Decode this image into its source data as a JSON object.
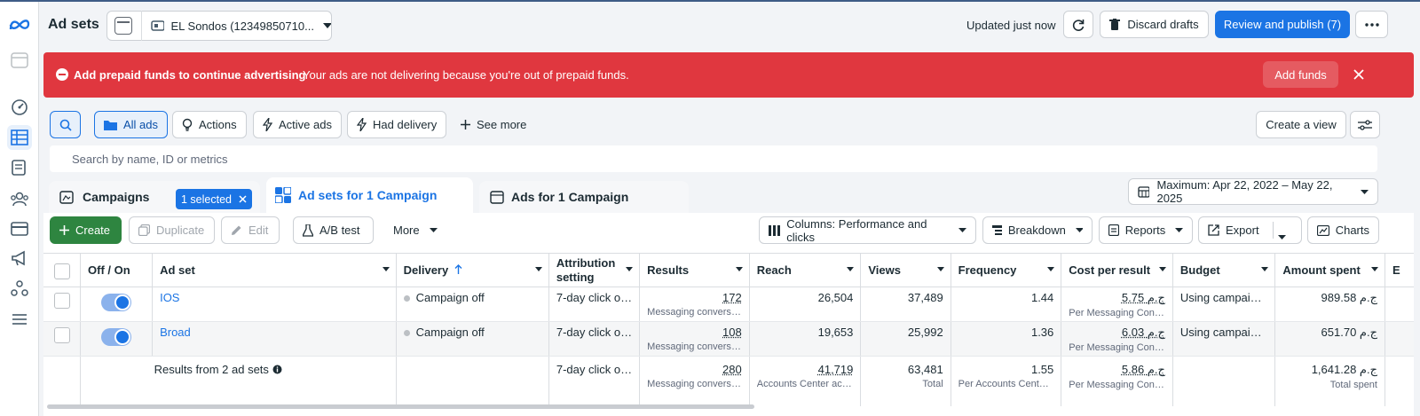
{
  "header": {
    "title": "Ad sets",
    "account_name": "EL Sondos (12349850710...",
    "updated": "Updated just now",
    "discard_label": "Discard drafts",
    "review_label": "Review and publish (7)"
  },
  "banner": {
    "title": "Add prepaid funds to continue advertising",
    "message": "Your ads are not delivering because you're out of prepaid funds.",
    "action": "Add funds"
  },
  "filters": {
    "all_ads": "All ads",
    "actions": "Actions",
    "active_ads": "Active ads",
    "had_delivery": "Had delivery",
    "see_more": "See more",
    "create_view": "Create a view",
    "search_placeholder": "Search by name, ID or metrics"
  },
  "tabs": {
    "campaigns": "Campaigns",
    "selected": "1 selected",
    "adsets": "Ad sets for 1 Campaign",
    "ads": "Ads for 1 Campaign",
    "date_range": "Maximum: Apr 22, 2022 – May 22, 2025"
  },
  "toolbar": {
    "create": "Create",
    "duplicate": "Duplicate",
    "edit": "Edit",
    "ab_test": "A/B test",
    "more": "More",
    "columns": "Columns: Performance and clicks",
    "breakdown": "Breakdown",
    "reports": "Reports",
    "export": "Export",
    "charts": "Charts"
  },
  "table": {
    "columns": [
      "Off / On",
      "Ad set",
      "Delivery",
      "Attribution setting",
      "Results",
      "Reach",
      "Views",
      "Frequency",
      "Cost per result",
      "Budget",
      "Amount spent",
      "E"
    ],
    "rows": [
      {
        "name": "IOS",
        "delivery": "Campaign off",
        "attribution": "7-day click or ...",
        "results": "172",
        "results_sub": "Messaging conversa...",
        "reach": "26,504",
        "views": "37,489",
        "frequency": "1.44",
        "cpr": "5.75 ج.م",
        "cpr_sub": "Per Messaging Conv...",
        "budget": "Using campaign...",
        "spent": "989.58 ج.م"
      },
      {
        "name": "Broad",
        "delivery": "Campaign off",
        "attribution": "7-day click or ...",
        "results": "108",
        "results_sub": "Messaging conversa...",
        "reach": "19,653",
        "views": "25,992",
        "frequency": "1.36",
        "cpr": "6.03 ج.م",
        "cpr_sub": "Per Messaging Conv...",
        "budget": "Using campaign...",
        "spent": "651.70 ج.م"
      }
    ],
    "total": {
      "label": "Results from 2 ad sets",
      "attribution": "7-day click or ...",
      "results": "280",
      "results_sub": "Messaging conversa...",
      "reach": "41,719",
      "reach_sub": "Accounts Center acc...",
      "views": "63,481",
      "views_sub": "Total",
      "frequency": "1.55",
      "frequency_sub": "Per Accounts Center ...",
      "cpr": "5.86 ج.م",
      "cpr_sub": "Per Messaging Conv...",
      "spent": "1,641.28 ج.م",
      "spent_sub": "Total spent"
    }
  }
}
